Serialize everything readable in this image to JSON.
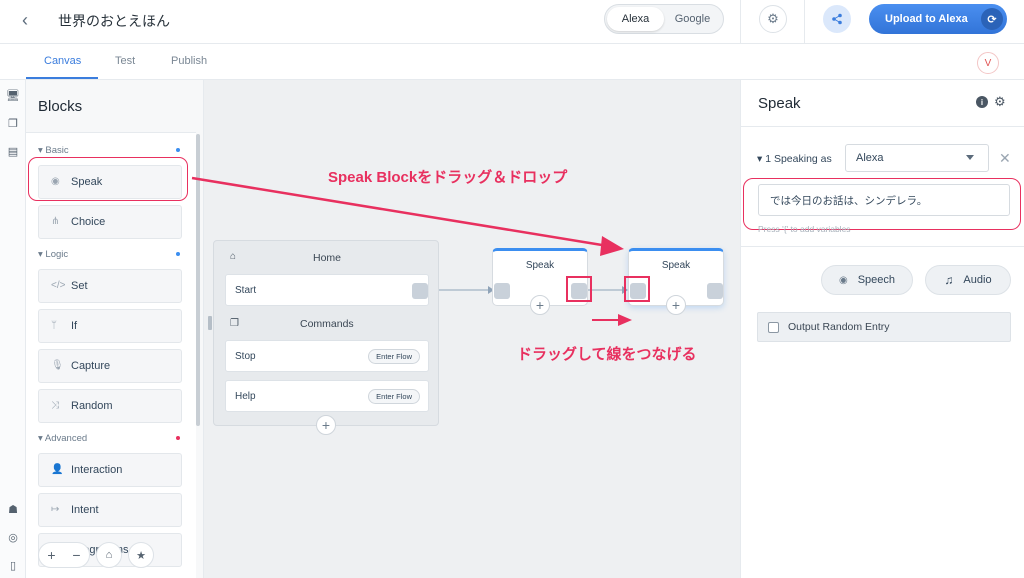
{
  "header": {
    "back_icon": "chevron-left-icon",
    "title": "世界のおとえほん",
    "platforms": [
      "Alexa",
      "Google"
    ],
    "active_platform": "Alexa",
    "settings_icon": "gear-icon",
    "share_icon": "share-icon",
    "upload_label": "Upload to Alexa",
    "upload_accent": "#3b7ddd"
  },
  "tabs": [
    "Canvas",
    "Test",
    "Publish"
  ],
  "active_tab": "Canvas",
  "user_avatar": "V",
  "blocks": {
    "title": "Blocks",
    "sections": [
      {
        "name": "Basic",
        "dot_color": "#3b8ef0",
        "items": [
          "Speak",
          "Choice"
        ]
      },
      {
        "name": "Logic",
        "dot_color": "#3b8ef0",
        "items": [
          "Set",
          "If",
          "Capture",
          "Random"
        ]
      },
      {
        "name": "Advanced",
        "dot_color": "#e8305f",
        "items": [
          "Interaction",
          "Intent",
          "Integrations"
        ]
      }
    ]
  },
  "canvas": {
    "home": {
      "title": "Home",
      "start_label": "Start",
      "commands_title": "Commands",
      "commands": [
        {
          "label": "Stop",
          "action": "Enter Flow"
        },
        {
          "label": "Help",
          "action": "Enter Flow"
        }
      ]
    },
    "nodes": [
      {
        "label": "Speak"
      },
      {
        "label": "Speak"
      }
    ],
    "annotations": {
      "drag_drop": "Speak Blockをドラッグ＆ドロップ",
      "connect": "ドラッグして線をつなげる"
    }
  },
  "props": {
    "title": "Speak",
    "info_icon": "info-icon",
    "gear_icon": "gear-icon",
    "speaking_as_label": "1 Speaking as",
    "voice": "Alexa",
    "speech_text": "では今日のお話は、シンデレラ。",
    "hint": "Press '{' to add variables",
    "speech_button": "Speech",
    "audio_button": "Audio",
    "random_label": "Output Random Entry"
  },
  "colors": {
    "annotation": "#e8305f",
    "accent": "#3b7ddd"
  }
}
